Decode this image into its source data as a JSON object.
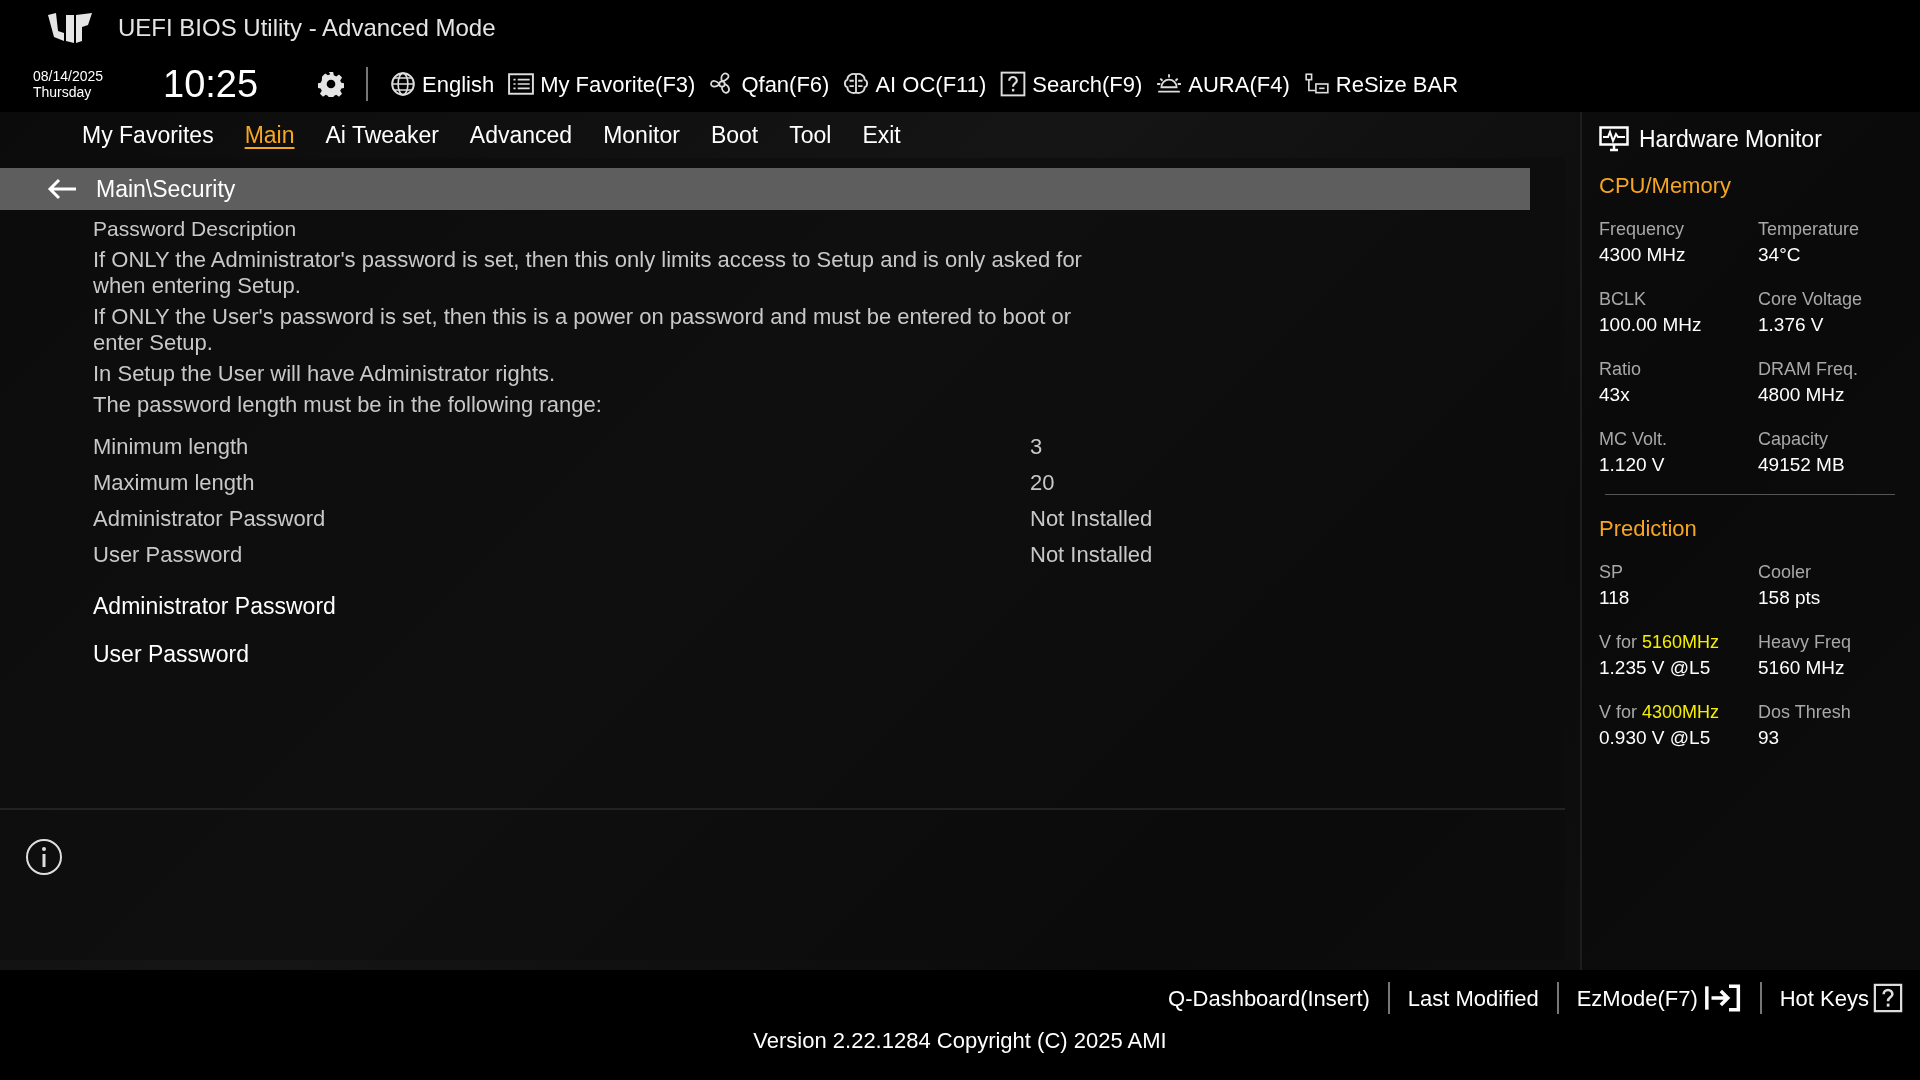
{
  "header": {
    "title": "UEFI BIOS Utility - Advanced Mode",
    "date": "08/14/2025",
    "weekday": "Thursday",
    "time": "10:25",
    "toolbar": [
      {
        "kind": "globe",
        "label": "English"
      },
      {
        "kind": "list",
        "label": "My Favorite(F3)"
      },
      {
        "kind": "fan",
        "label": "Qfan(F6)"
      },
      {
        "kind": "brain",
        "label": "AI OC(F11)"
      },
      {
        "kind": "help",
        "label": "Search(F9)"
      },
      {
        "kind": "light",
        "label": "AURA(F4)"
      },
      {
        "kind": "bar",
        "label": "ReSize BAR"
      }
    ]
  },
  "tabs": [
    {
      "label": "My Favorites",
      "selected": false
    },
    {
      "label": "Main",
      "selected": true
    },
    {
      "label": "Ai Tweaker",
      "selected": false
    },
    {
      "label": "Advanced",
      "selected": false
    },
    {
      "label": "Monitor",
      "selected": false
    },
    {
      "label": "Boot",
      "selected": false
    },
    {
      "label": "Tool",
      "selected": false
    },
    {
      "label": "Exit",
      "selected": false
    }
  ],
  "breadcrumb": "Main\\Security",
  "description": [
    "Password Description",
    "If ONLY the Administrator's password is set, then this only limits access to Setup and is only asked for when entering Setup.",
    "If ONLY the User's password is set, then this is a power on password and must be entered to boot or enter Setup.",
    "In Setup the User will have Administrator rights.",
    "The password length must be in the following range:"
  ],
  "settings": [
    {
      "label": "Minimum length",
      "value": "3"
    },
    {
      "label": "Maximum length",
      "value": "20"
    },
    {
      "label": "Administrator Password",
      "value": "Not Installed"
    },
    {
      "label": "User Password",
      "value": "Not Installed"
    }
  ],
  "actions": [
    "Administrator Password",
    "User Password"
  ],
  "hardware_monitor": {
    "title": "Hardware Monitor",
    "sections": [
      {
        "title": "CPU/Memory",
        "items": [
          {
            "label": "Frequency",
            "value": "4300 MHz"
          },
          {
            "label": "Temperature",
            "value": "34°C"
          },
          {
            "label": "BCLK",
            "value": "100.00 MHz"
          },
          {
            "label": "Core Voltage",
            "value": "1.376 V"
          },
          {
            "label": "Ratio",
            "value": "43x"
          },
          {
            "label": "DRAM Freq.",
            "value": "4800 MHz"
          },
          {
            "label": "MC Volt.",
            "value": "1.120 V"
          },
          {
            "label": "Capacity",
            "value": "49152 MB"
          }
        ]
      },
      {
        "title": "Prediction",
        "items": [
          {
            "label": "SP",
            "value": "118"
          },
          {
            "label": "Cooler",
            "value": "158 pts"
          },
          {
            "label": "V for",
            "highlight": "5160MHz",
            "value": "1.235 V @L5"
          },
          {
            "label": "Heavy Freq",
            "value": "5160 MHz"
          },
          {
            "label": "V for",
            "highlight": "4300MHz",
            "value": "0.930 V @L5"
          },
          {
            "label": "Dos Thresh",
            "value": "93"
          }
        ]
      }
    ]
  },
  "footer": {
    "buttons": [
      {
        "kind": "plain",
        "label": "Q-Dashboard(Insert)"
      },
      {
        "kind": "plain",
        "label": "Last Modified"
      },
      {
        "kind": "exit",
        "label": "EzMode(F7)"
      },
      {
        "kind": "help",
        "label": "Hot Keys"
      }
    ],
    "version": "Version 2.22.1284 Copyright (C) 2025 AMI"
  }
}
